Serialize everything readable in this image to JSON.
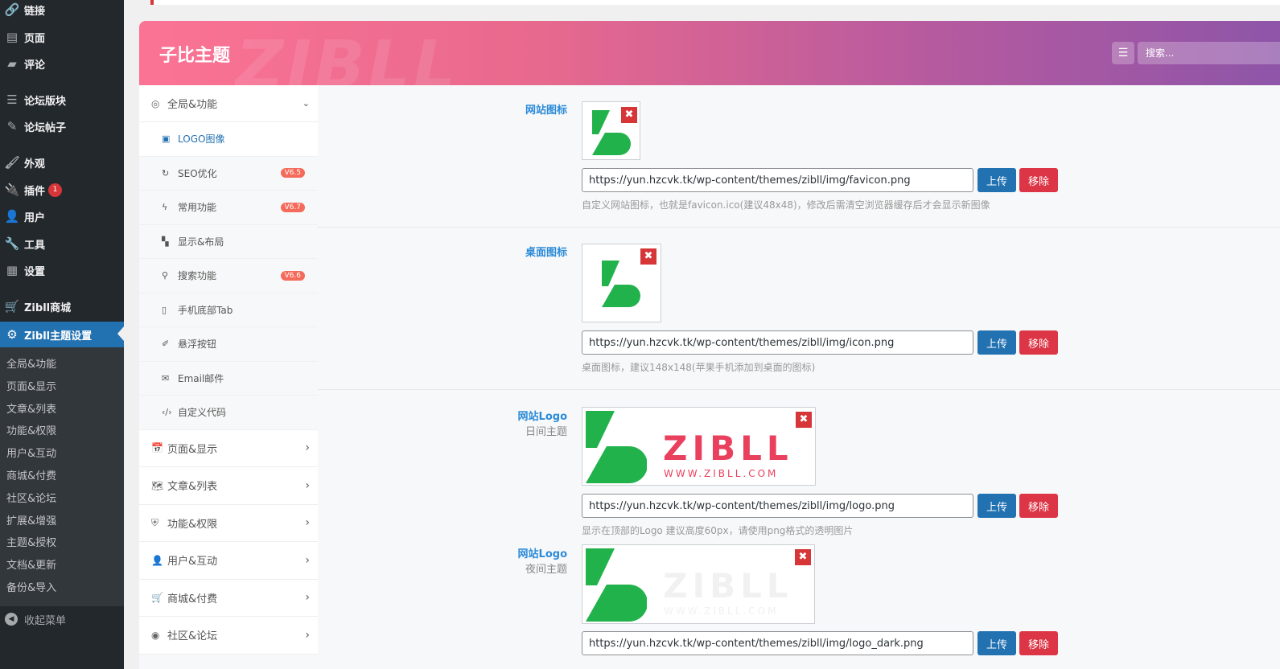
{
  "wp_menu": {
    "links": "链接",
    "pages": "页面",
    "comments": "评论",
    "forum_boards": "论坛版块",
    "forum_posts": "论坛帖子",
    "appearance": "外观",
    "plugins": "插件",
    "plugins_badge": "1",
    "users": "用户",
    "tools": "工具",
    "settings": "设置",
    "shop": "Zibll商城",
    "theme_settings": "Zibll主题设置",
    "collapse": "收起菜单"
  },
  "wp_submenu": [
    "全局&功能",
    "页面&显示",
    "文章&列表",
    "功能&权限",
    "用户&互动",
    "商城&付费",
    "社区&论坛",
    "扩展&增强",
    "主题&授权",
    "文档&更新",
    "备份&导入"
  ],
  "header": {
    "title": "子比主题",
    "watermark": "ZIBLL",
    "search_placeholder": "搜索..."
  },
  "nav": {
    "top": "全局&功能",
    "subs": [
      {
        "label": "LOGO图像",
        "icon": "image-icon"
      },
      {
        "label": "SEO优化",
        "icon": "seo-icon",
        "badge": "V6.5"
      },
      {
        "label": "常用功能",
        "icon": "bolt-icon",
        "badge": "V6.7"
      },
      {
        "label": "显示&布局",
        "icon": "layout-icon"
      },
      {
        "label": "搜索功能",
        "icon": "search-icon",
        "badge": "V6.6"
      },
      {
        "label": "手机底部Tab",
        "icon": "mobile-icon"
      },
      {
        "label": "悬浮按钮",
        "icon": "pin-icon"
      },
      {
        "label": "Email邮件",
        "icon": "mail-icon"
      },
      {
        "label": "自定义代码",
        "icon": "code-icon"
      }
    ],
    "sections": [
      "页面&显示",
      "文章&列表",
      "功能&权限",
      "用户&互动",
      "商城&付费",
      "社区&论坛"
    ]
  },
  "fields": {
    "favicon": {
      "title": "网站图标",
      "url": "https://yun.hzcvk.tk/wp-content/themes/zibll/img/favicon.png",
      "help": "自定义网站图标，也就是favicon.ico(建议48x48)，修改后需清空浏览器缓存后才会显示新图像"
    },
    "icon": {
      "title": "桌面图标",
      "url": "https://yun.hzcvk.tk/wp-content/themes/zibll/img/icon.png",
      "help": "桌面图标，建议148x148(苹果手机添加到桌面的图标)"
    },
    "logo_day": {
      "title": "网站Logo",
      "subtitle": "日间主题",
      "url": "https://yun.hzcvk.tk/wp-content/themes/zibll/img/logo.png",
      "help": "显示在顶部的Logo 建议高度60px，请使用png格式的透明图片"
    },
    "logo_night": {
      "title": "网站Logo",
      "subtitle": "夜间主题",
      "url": "https://yun.hzcvk.tk/wp-content/themes/zibll/img/logo_dark.png"
    }
  },
  "buttons": {
    "upload": "上传",
    "remove": "移除"
  },
  "logo": {
    "wordmark": "ZIBLL",
    "domain": "WWW.ZIBLL.COM"
  },
  "colors": {
    "brand_green": "#22b24c",
    "brand_red": "#e9405e",
    "accent_blue": "#2271b1",
    "danger": "#dc3545"
  }
}
